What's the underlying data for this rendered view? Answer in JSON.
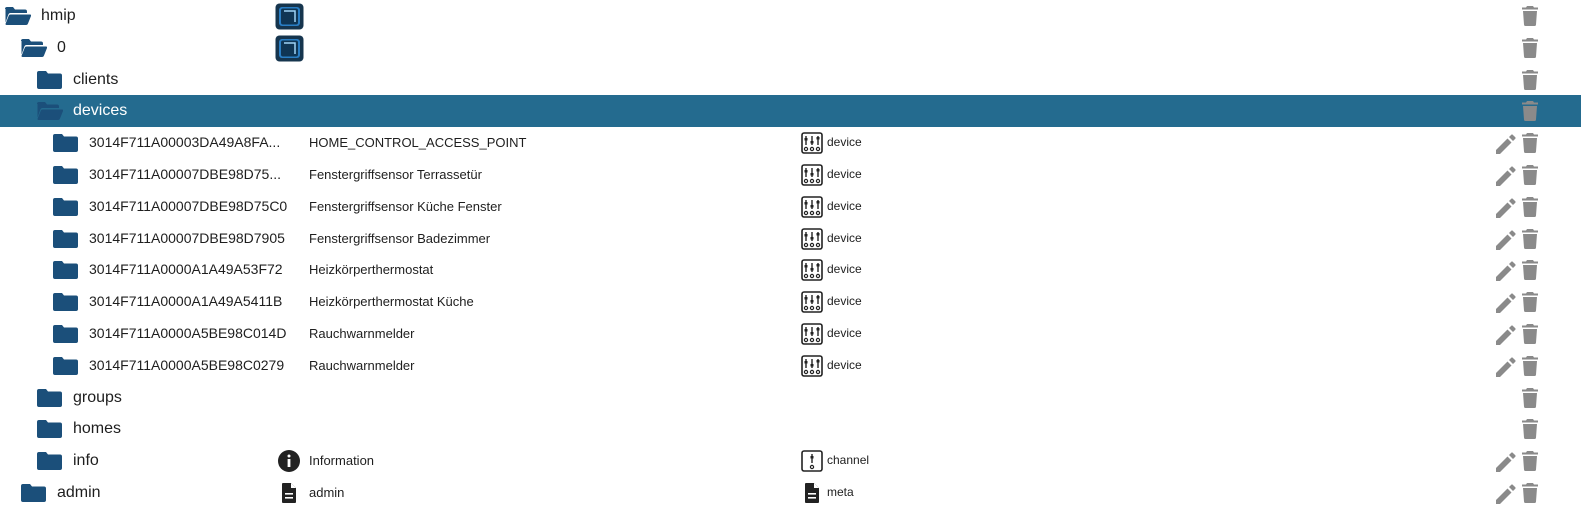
{
  "tree": {
    "hmip": {
      "name": "hmip"
    },
    "instance": {
      "name": "0"
    },
    "clients": {
      "name": "clients"
    },
    "devices": {
      "name": "devices"
    },
    "device_rows": [
      {
        "id": "3014F711A00003DA49A8FA...",
        "desc": "HOME_CONTROL_ACCESS_POINT",
        "type": "device"
      },
      {
        "id": "3014F711A00007DBE98D75...",
        "desc": "Fenstergriffsensor Terrassetür",
        "type": "device"
      },
      {
        "id": "3014F711A00007DBE98D75C0",
        "desc": "Fenstergriffsensor Küche Fenster",
        "type": "device"
      },
      {
        "id": "3014F711A00007DBE98D7905",
        "desc": "Fenstergriffsensor Badezimmer",
        "type": "device"
      },
      {
        "id": "3014F711A0000A1A49A53F72",
        "desc": "Heizkörperthermostat",
        "type": "device"
      },
      {
        "id": "3014F711A0000A1A49A5411B",
        "desc": "Heizkörperthermostat Küche",
        "type": "device"
      },
      {
        "id": "3014F711A0000A5BE98C014D",
        "desc": "Rauchwarnmelder",
        "type": "device"
      },
      {
        "id": "3014F711A0000A5BE98C0279",
        "desc": "Rauchwarnmelder",
        "type": "device"
      }
    ],
    "groups": {
      "name": "groups"
    },
    "homes": {
      "name": "homes"
    },
    "info": {
      "name": "info",
      "desc": "Information",
      "type": "channel"
    },
    "admin": {
      "name": "admin",
      "desc": "admin",
      "type": "meta"
    }
  },
  "colors": {
    "folder": "#1b4f7a",
    "selected_bg": "#246b8f",
    "icon_grey": "#8a8a8a"
  },
  "icons": {
    "folder": "folder-icon",
    "folder_open": "folder-open-icon",
    "trash": "trash-icon",
    "edit": "pencil-icon",
    "device": "device-sliders-icon",
    "channel": "channel-icon",
    "info": "info-icon",
    "file": "file-icon"
  }
}
